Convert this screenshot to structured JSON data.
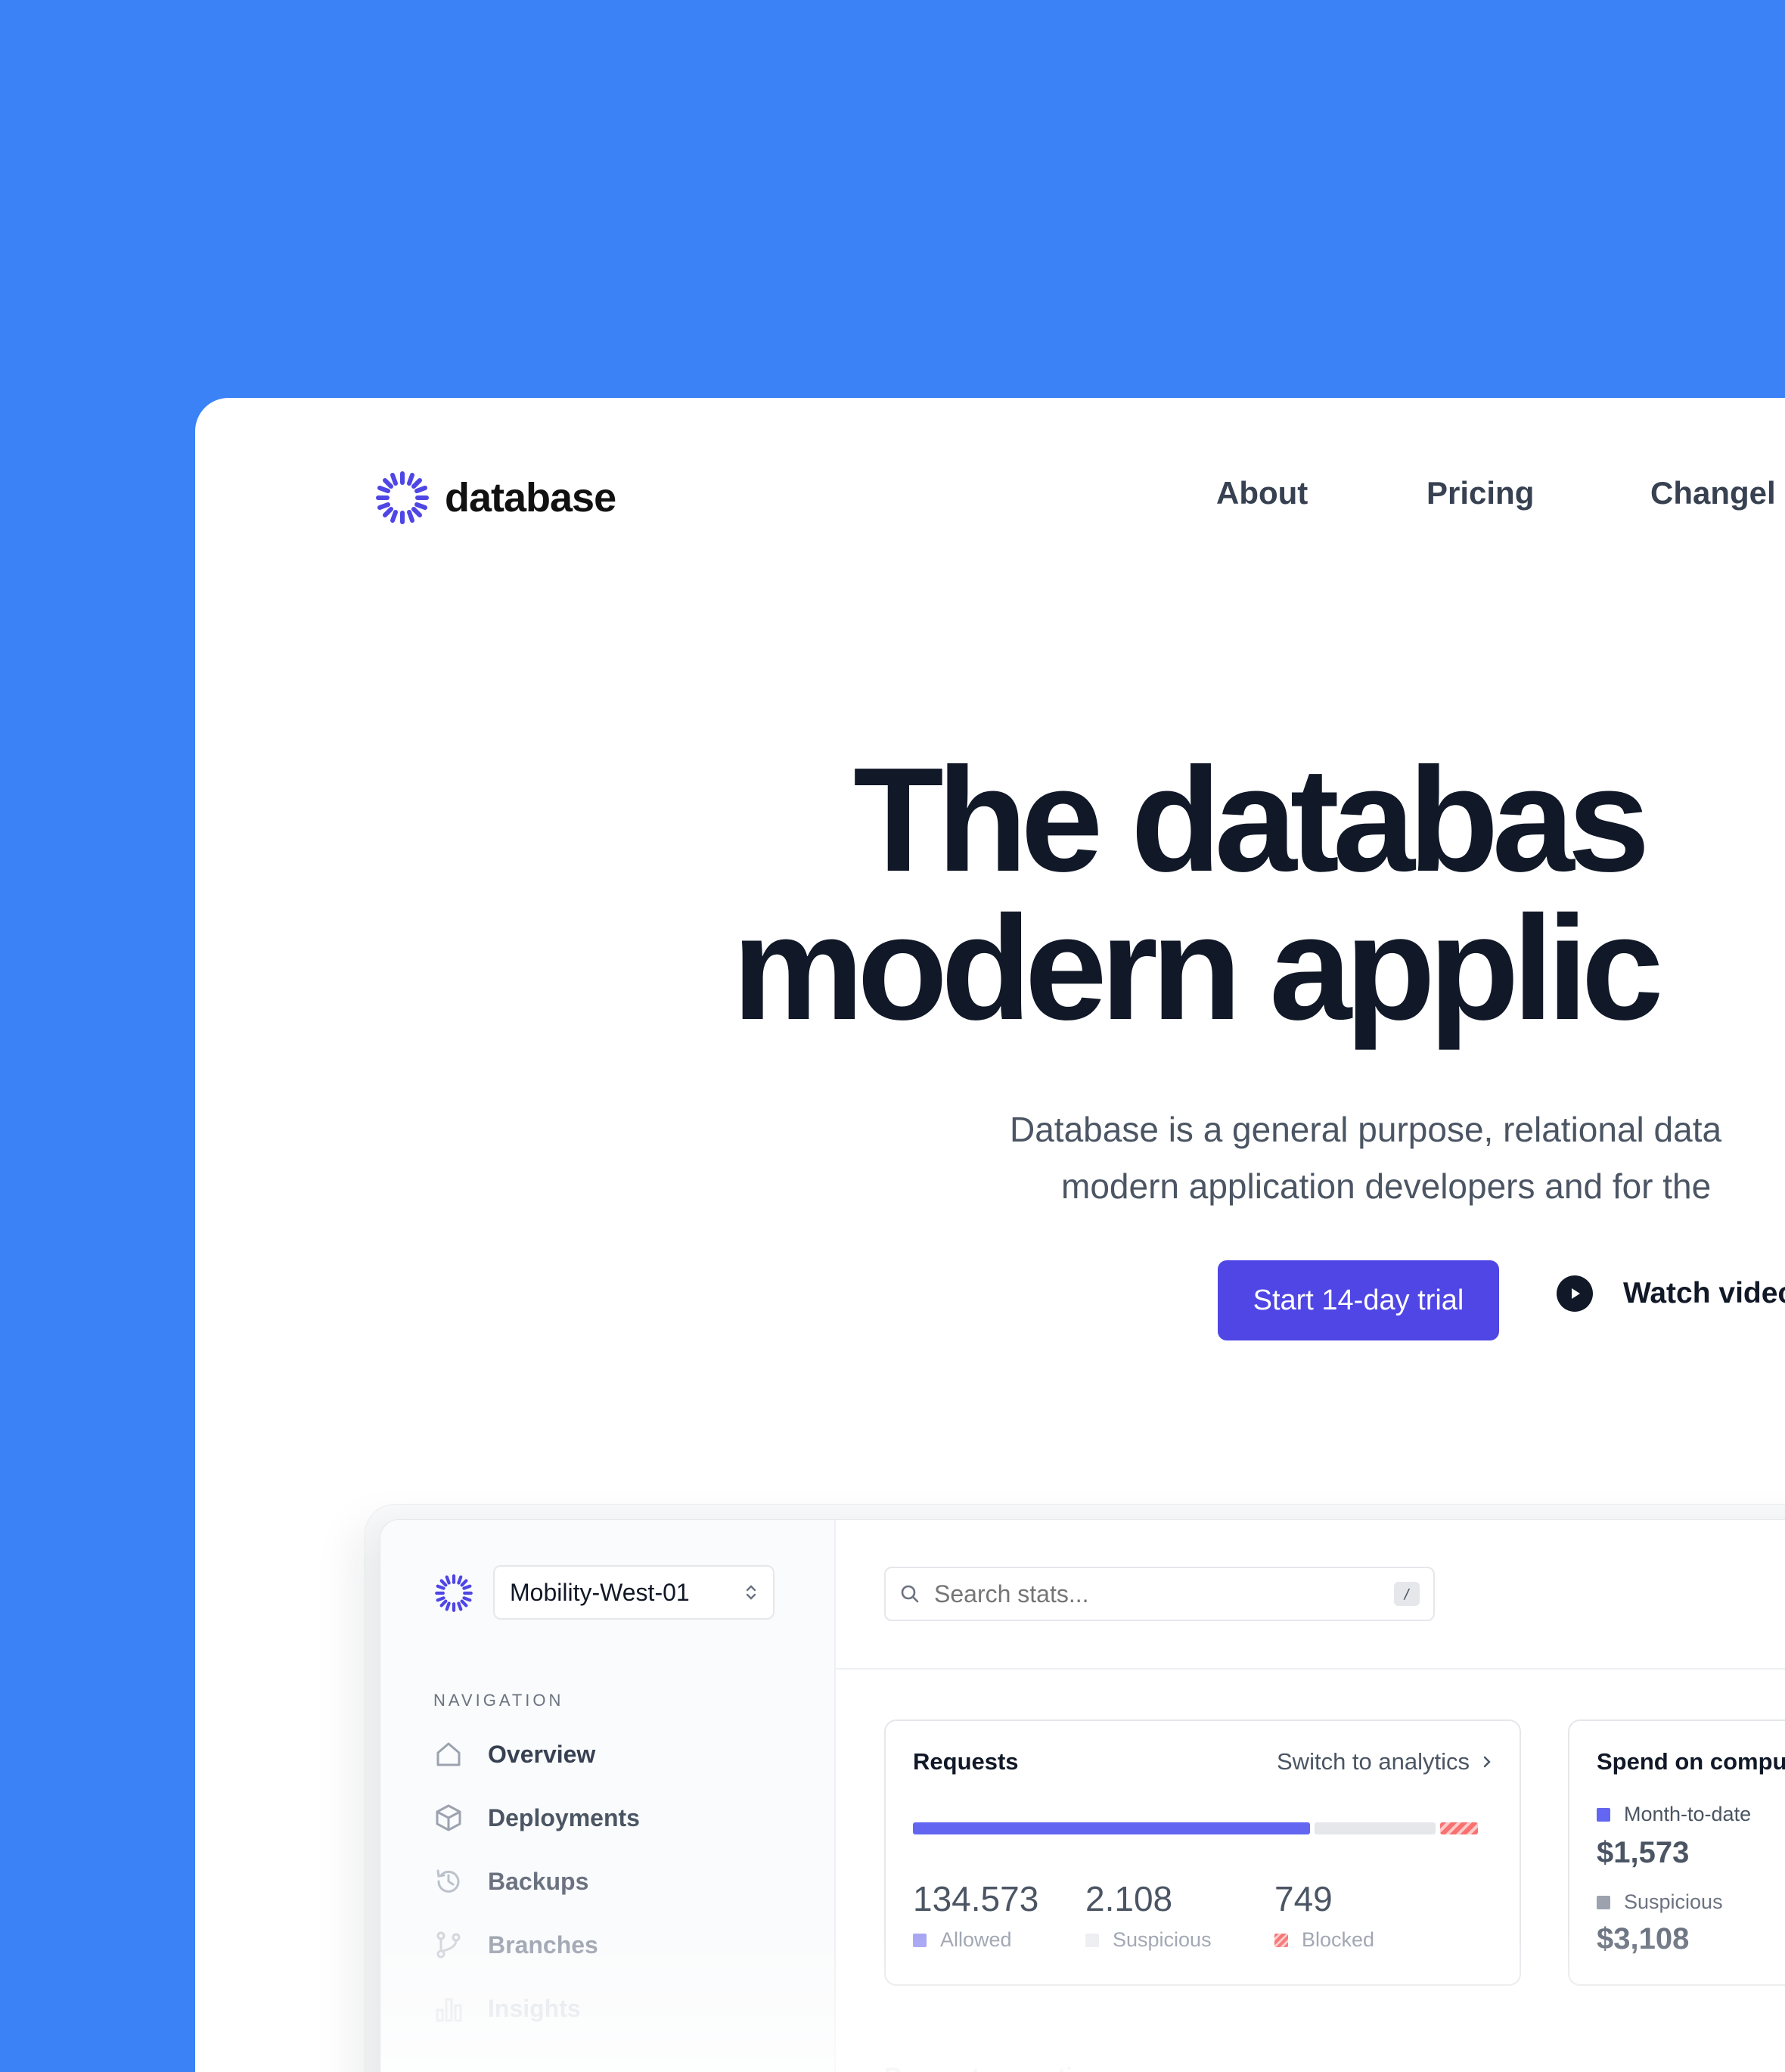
{
  "header": {
    "logo_text": "database",
    "nav": [
      {
        "label": "About"
      },
      {
        "label": "Pricing"
      },
      {
        "label": "Changel"
      }
    ]
  },
  "hero": {
    "title_line1": "The databas",
    "title_line2": "modern applic",
    "subtitle_line1": "Database is a general purpose, relational data",
    "subtitle_line2": "modern application developers and for the",
    "primary_cta": "Start 14-day trial",
    "secondary_cta": "Watch video"
  },
  "app": {
    "project": "Mobility-West-01",
    "search": {
      "placeholder": "Search stats...",
      "shortcut": "/"
    },
    "navigation": {
      "heading": "NAVIGATION",
      "items": [
        {
          "label": "Overview",
          "icon": "home-icon",
          "color": "#374151"
        },
        {
          "label": "Deployments",
          "icon": "cube-icon",
          "color": "#4b5563"
        },
        {
          "label": "Backups",
          "icon": "history-icon",
          "color": "#6b7280"
        },
        {
          "label": "Branches",
          "icon": "git-branch-icon",
          "color": "#9ca3af"
        },
        {
          "label": "Insights",
          "icon": "bar-chart-icon",
          "color": "#dfe3ea"
        }
      ]
    },
    "requests_card": {
      "title": "Requests",
      "link": "Switch to analytics",
      "stats": [
        {
          "value": "134.573",
          "label": "Allowed",
          "color": "#6366f1"
        },
        {
          "value": "2.108",
          "label": "Suspicious",
          "color": "#d1d5db"
        },
        {
          "value": "749",
          "label": "Blocked",
          "color": "#f87171"
        }
      ]
    },
    "spend_card": {
      "title": "Spend on compu",
      "rows": [
        {
          "label": "Month-to-date",
          "value": "$1,573",
          "color": "#6366f1"
        },
        {
          "label": "Suspicious",
          "value": "$3,108",
          "color": "#9ca3af"
        }
      ]
    },
    "section_heading": "Requests over time"
  },
  "colors": {
    "background": "#3b82f6",
    "brand": "#4f46e5",
    "text_dark": "#111827"
  }
}
